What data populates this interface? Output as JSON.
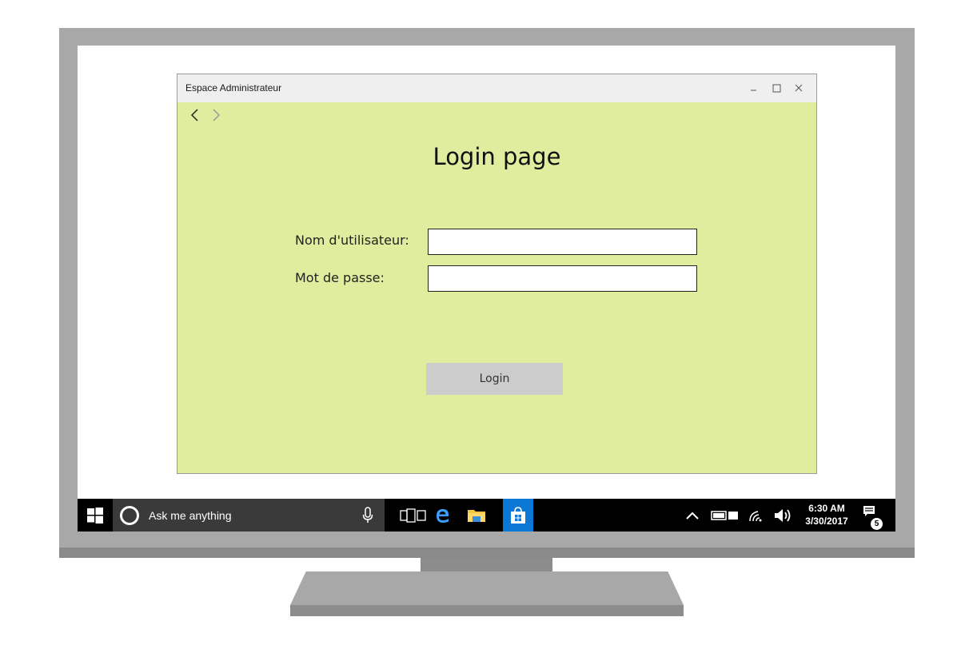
{
  "window": {
    "title": "Espace Administrateur",
    "background_color": "#e0ed9e"
  },
  "page": {
    "title": "Login page"
  },
  "form": {
    "username_label": "Nom d'utilisateur:",
    "username_value": "",
    "password_label": "Mot de passe:",
    "password_value": "",
    "login_label": "Login"
  },
  "taskbar": {
    "search_placeholder": "Ask me anything",
    "clock_time": "6:30 AM",
    "clock_date": "3/30/2017",
    "notification_count": "5",
    "pinned_icons": [
      "task-view-icon",
      "edge-icon",
      "file-explorer-icon",
      "store-icon"
    ],
    "tray_icons": [
      "chevron-up-icon",
      "battery-icon",
      "wifi-icon",
      "volume-icon"
    ]
  }
}
